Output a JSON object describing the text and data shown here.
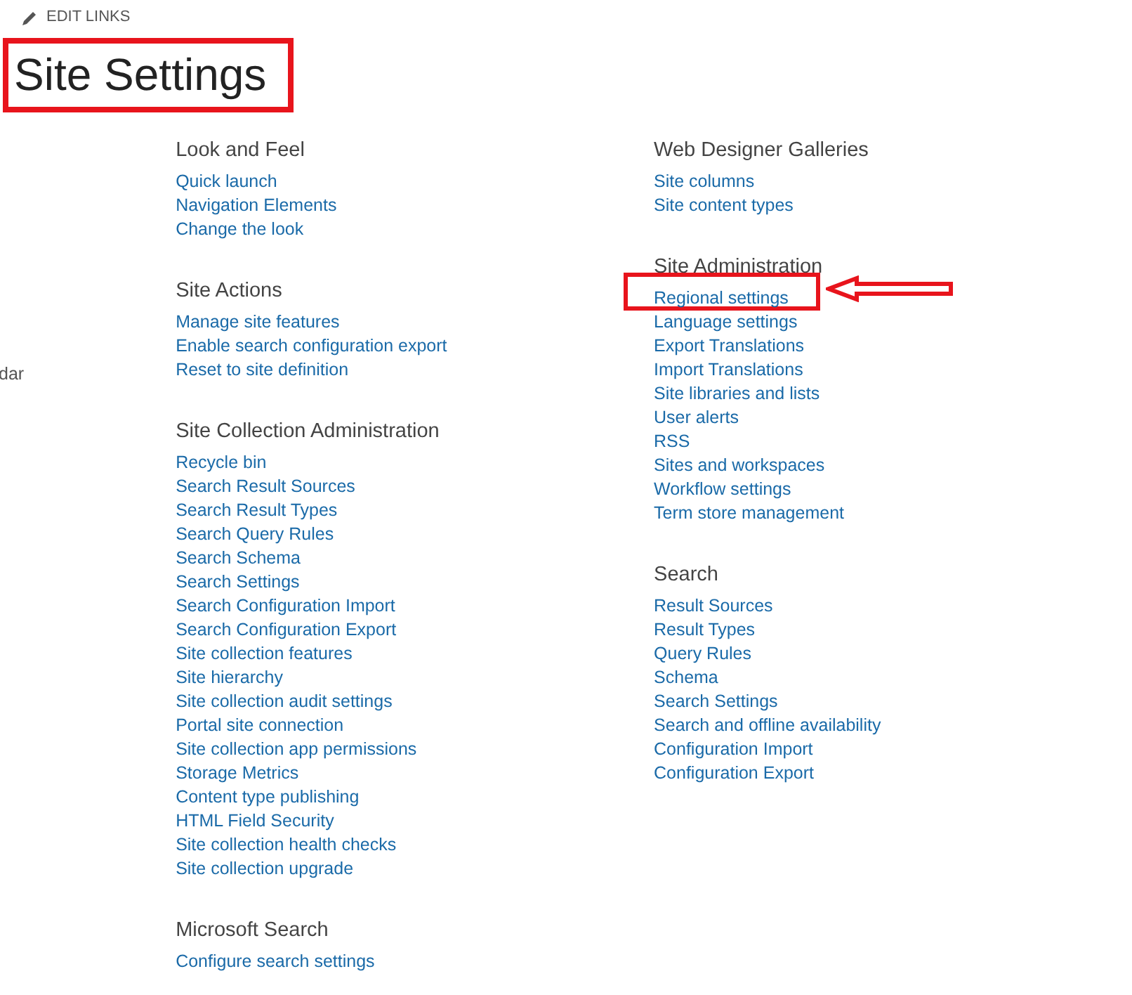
{
  "edit_links": "EDIT LINKS",
  "title": {
    "text": "Site Settings",
    "highlighted": true
  },
  "left_nav": [
    "dar"
  ],
  "columns": [
    [
      {
        "heading": "Look and Feel",
        "links": [
          {
            "label": "Quick launch",
            "highlighted": false
          },
          {
            "label": "Navigation Elements",
            "highlighted": false
          },
          {
            "label": "Change the look",
            "highlighted": false
          }
        ]
      },
      {
        "heading": "Site Actions",
        "links": [
          {
            "label": "Manage site features",
            "highlighted": false
          },
          {
            "label": "Enable search configuration export",
            "highlighted": false
          },
          {
            "label": "Reset to site definition",
            "highlighted": false
          }
        ]
      },
      {
        "heading": "Site Collection Administration",
        "links": [
          {
            "label": "Recycle bin",
            "highlighted": false
          },
          {
            "label": "Search Result Sources",
            "highlighted": false
          },
          {
            "label": "Search Result Types",
            "highlighted": false
          },
          {
            "label": "Search Query Rules",
            "highlighted": false
          },
          {
            "label": "Search Schema",
            "highlighted": false
          },
          {
            "label": "Search Settings",
            "highlighted": false
          },
          {
            "label": "Search Configuration Import",
            "highlighted": false
          },
          {
            "label": "Search Configuration Export",
            "highlighted": false
          },
          {
            "label": "Site collection features",
            "highlighted": false
          },
          {
            "label": "Site hierarchy",
            "highlighted": false
          },
          {
            "label": "Site collection audit settings",
            "highlighted": false
          },
          {
            "label": "Portal site connection",
            "highlighted": false
          },
          {
            "label": "Site collection app permissions",
            "highlighted": false
          },
          {
            "label": "Storage Metrics",
            "highlighted": false
          },
          {
            "label": "Content type publishing",
            "highlighted": false
          },
          {
            "label": "HTML Field Security",
            "highlighted": false
          },
          {
            "label": "Site collection health checks",
            "highlighted": false
          },
          {
            "label": "Site collection upgrade",
            "highlighted": false
          }
        ]
      },
      {
        "heading": "Microsoft Search",
        "links": [
          {
            "label": "Configure search settings",
            "highlighted": false
          }
        ]
      }
    ],
    [
      {
        "heading": "Web Designer Galleries",
        "links": [
          {
            "label": "Site columns",
            "highlighted": false
          },
          {
            "label": "Site content types",
            "highlighted": false
          }
        ]
      },
      {
        "heading": "Site Administration",
        "links": [
          {
            "label": "Regional settings",
            "highlighted": true
          },
          {
            "label": "Language settings",
            "highlighted": false
          },
          {
            "label": "Export Translations",
            "highlighted": false
          },
          {
            "label": "Import Translations",
            "highlighted": false
          },
          {
            "label": "Site libraries and lists",
            "highlighted": false
          },
          {
            "label": "User alerts",
            "highlighted": false
          },
          {
            "label": "RSS",
            "highlighted": false
          },
          {
            "label": "Sites and workspaces",
            "highlighted": false
          },
          {
            "label": "Workflow settings",
            "highlighted": false
          },
          {
            "label": "Term store management",
            "highlighted": false
          }
        ]
      },
      {
        "heading": "Search",
        "links": [
          {
            "label": "Result Sources",
            "highlighted": false
          },
          {
            "label": "Result Types",
            "highlighted": false
          },
          {
            "label": "Query Rules",
            "highlighted": false
          },
          {
            "label": "Schema",
            "highlighted": false
          },
          {
            "label": "Search Settings",
            "highlighted": false
          },
          {
            "label": "Search and offline availability",
            "highlighted": false
          },
          {
            "label": "Configuration Import",
            "highlighted": false
          },
          {
            "label": "Configuration Export",
            "highlighted": false
          }
        ]
      }
    ]
  ]
}
